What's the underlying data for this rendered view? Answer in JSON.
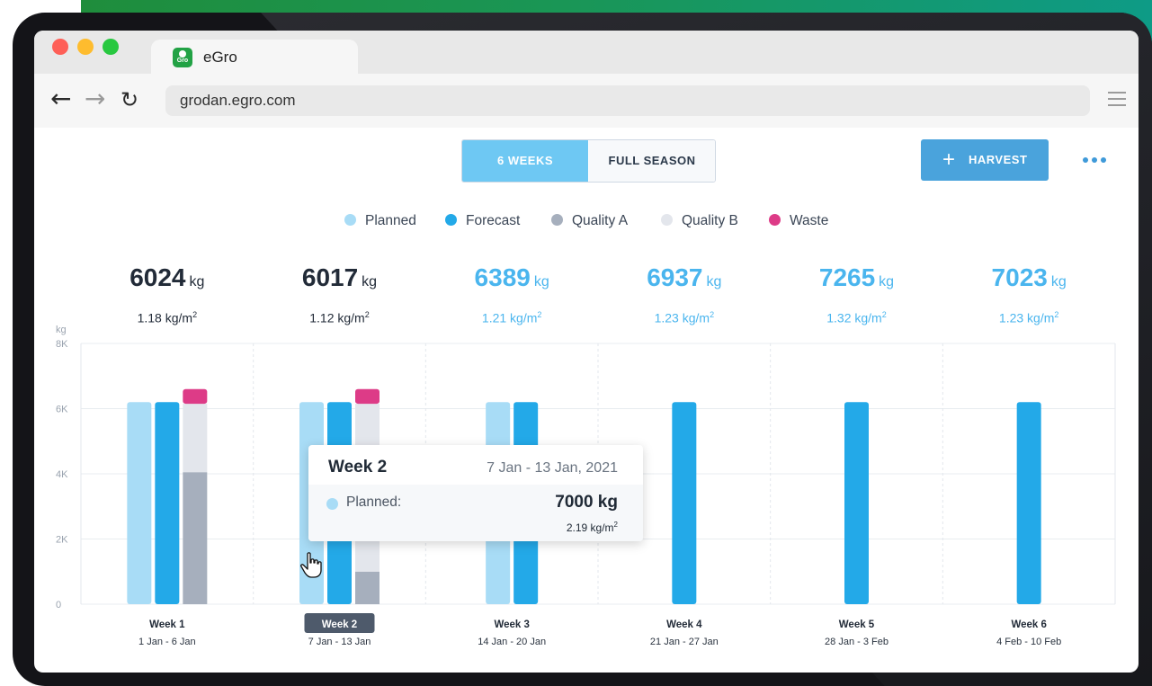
{
  "browser": {
    "tab_title": "eGro",
    "tab_favicon_text": "Gro",
    "url": "grodan.egro.com"
  },
  "controls": {
    "segments": [
      {
        "label": "6 WEEKS",
        "selected": true
      },
      {
        "label": "FULL SEASON",
        "selected": false
      }
    ],
    "harvest_button": "HARVEST",
    "more_icon": "more-dots-icon"
  },
  "legend": [
    {
      "label": "Planned",
      "color": "#a8dcf6"
    },
    {
      "label": "Forecast",
      "color": "#23a9e8"
    },
    {
      "label": "Quality A",
      "color": "#a6afbd"
    },
    {
      "label": "Quality B",
      "color": "#e3e6ec"
    },
    {
      "label": "Waste",
      "color": "#dd3b87"
    }
  ],
  "weeks": [
    {
      "label": "Week 1",
      "range": "1 Jan - 6 Jan",
      "total": "6024",
      "unit": "kg",
      "density": "1.18 kg/m",
      "density_exp": "2",
      "actual": true,
      "selected": false
    },
    {
      "label": "Week 2",
      "range": "7 Jan  -  13 Jan",
      "total": "6017",
      "unit": "kg",
      "density": "1.12 kg/m",
      "density_exp": "2",
      "actual": true,
      "selected": true
    },
    {
      "label": "Week 3",
      "range": "14 Jan - 20 Jan",
      "total": "6389",
      "unit": "kg",
      "density": "1.21 kg/m",
      "density_exp": "2",
      "actual": false,
      "selected": false
    },
    {
      "label": "Week 4",
      "range": "21 Jan - 27 Jan",
      "total": "6937",
      "unit": "kg",
      "density": "1.23 kg/m",
      "density_exp": "2",
      "actual": false,
      "selected": false
    },
    {
      "label": "Week 5",
      "range": "28 Jan - 3 Feb",
      "total": "7265",
      "unit": "kg",
      "density": "1.32 kg/m",
      "density_exp": "2",
      "actual": false,
      "selected": false
    },
    {
      "label": "Week 6",
      "range": "4 Feb - 10 Feb",
      "total": "7023",
      "unit": "kg",
      "density": "1.23 kg/m",
      "density_exp": "2",
      "actual": false,
      "selected": false
    }
  ],
  "chart_data": {
    "type": "bar",
    "ylabel": "kg",
    "ylim": [
      0,
      8000
    ],
    "y_ticks": [
      {
        "value": 0,
        "label": "0"
      },
      {
        "value": 2000,
        "label": "2K"
      },
      {
        "value": 4000,
        "label": "4K"
      },
      {
        "value": 6000,
        "label": "6K"
      },
      {
        "value": 8000,
        "label": "8K"
      }
    ],
    "categories": [
      "Week 1",
      "Week 2",
      "Week 3",
      "Week 4",
      "Week 5",
      "Week 6"
    ],
    "series": [
      {
        "name": "Planned",
        "values": [
          6200,
          6200,
          6200,
          null,
          null,
          null
        ]
      },
      {
        "name": "Forecast",
        "values": [
          6200,
          6200,
          6200,
          6200,
          6200,
          6200
        ]
      },
      {
        "name": "Quality A",
        "values": [
          4050,
          1000,
          null,
          null,
          null,
          null
        ]
      },
      {
        "name": "Quality B",
        "values": [
          2100,
          5150,
          null,
          null,
          null,
          null
        ]
      },
      {
        "name": "Waste",
        "values": [
          450,
          450,
          null,
          null,
          null,
          null
        ]
      }
    ],
    "grid": true
  },
  "tooltip": {
    "week": "Week 2",
    "range": "7 Jan - 13 Jan, 2021",
    "series": "Planned:",
    "value": "7000 kg",
    "density": "2.19 kg/m",
    "density_exp": "2"
  }
}
